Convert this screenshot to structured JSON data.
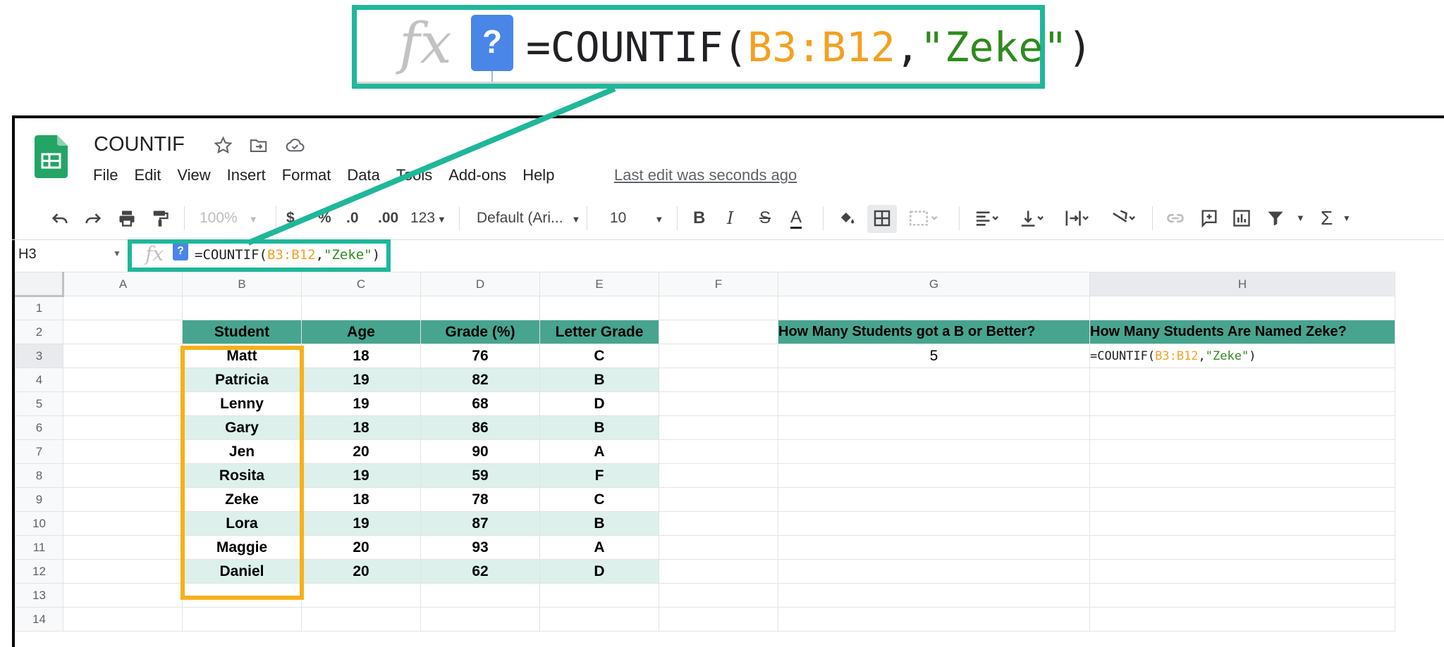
{
  "callout": {
    "fx_label": "fx",
    "help_badge": "?",
    "formula_prefix": "=COUNTIF(",
    "formula_range": "B3:B12",
    "formula_comma": ",",
    "formula_string": "\"Zeke\"",
    "formula_suffix": ")"
  },
  "app": {
    "doc_title": "COUNTIF",
    "menu": [
      "File",
      "Edit",
      "View",
      "Insert",
      "Format",
      "Data",
      "Tools",
      "Add-ons",
      "Help"
    ],
    "last_edit": "Last edit was seconds ago"
  },
  "toolbar": {
    "zoom": "100%",
    "currency": "$",
    "percent": "%",
    "decrease_decimal": ".0",
    "increase_decimal": ".00",
    "more_formats": "123",
    "font": "Default (Ari...",
    "font_size": "10",
    "bold": "B",
    "italic": "I",
    "strikethrough": "S",
    "text_color": "A",
    "sum": "Σ"
  },
  "formula_bar": {
    "name_box": "H3",
    "fx": "fx",
    "help": "?",
    "formula_prefix": "=COUNTIF(",
    "formula_range": "B3:B12",
    "formula_comma": ",",
    "formula_string": "\"Zeke\"",
    "formula_suffix": ")"
  },
  "grid": {
    "columns": [
      "A",
      "B",
      "C",
      "D",
      "E",
      "F",
      "G",
      "H"
    ],
    "rows": [
      "1",
      "2",
      "3",
      "4",
      "5",
      "6",
      "7",
      "8",
      "9",
      "10",
      "11",
      "12",
      "13",
      "14"
    ],
    "table_headers": [
      "Student",
      "Age",
      "Grade (%)",
      "Letter Grade"
    ],
    "table_rows": [
      [
        "Matt",
        "18",
        "76",
        "C"
      ],
      [
        "Patricia",
        "19",
        "82",
        "B"
      ],
      [
        "Lenny",
        "19",
        "68",
        "D"
      ],
      [
        "Gary",
        "18",
        "86",
        "B"
      ],
      [
        "Jen",
        "20",
        "90",
        "A"
      ],
      [
        "Rosita",
        "19",
        "59",
        "F"
      ],
      [
        "Zeke",
        "18",
        "78",
        "C"
      ],
      [
        "Lora",
        "19",
        "87",
        "B"
      ],
      [
        "Maggie",
        "20",
        "93",
        "A"
      ],
      [
        "Daniel",
        "20",
        "62",
        "D"
      ]
    ],
    "g2": "How Many Students got a B or Better?",
    "h2": "How Many Students Are Named Zeke?",
    "g3": "5",
    "h3_prefix": "=COUNTIF(",
    "h3_range": "B3:B12",
    "h3_comma": ",",
    "h3_string": "\"Zeke\"",
    "h3_suffix": ")"
  },
  "colors": {
    "callout_border": "#1fb79a",
    "highlight_border": "#f5b11a",
    "header_fill": "#47a48f",
    "alt_row_fill": "#ddf0ec",
    "formula_range": "#f4a021",
    "formula_string": "#2e8b1e",
    "active_cell_border": "#1a73e8"
  }
}
